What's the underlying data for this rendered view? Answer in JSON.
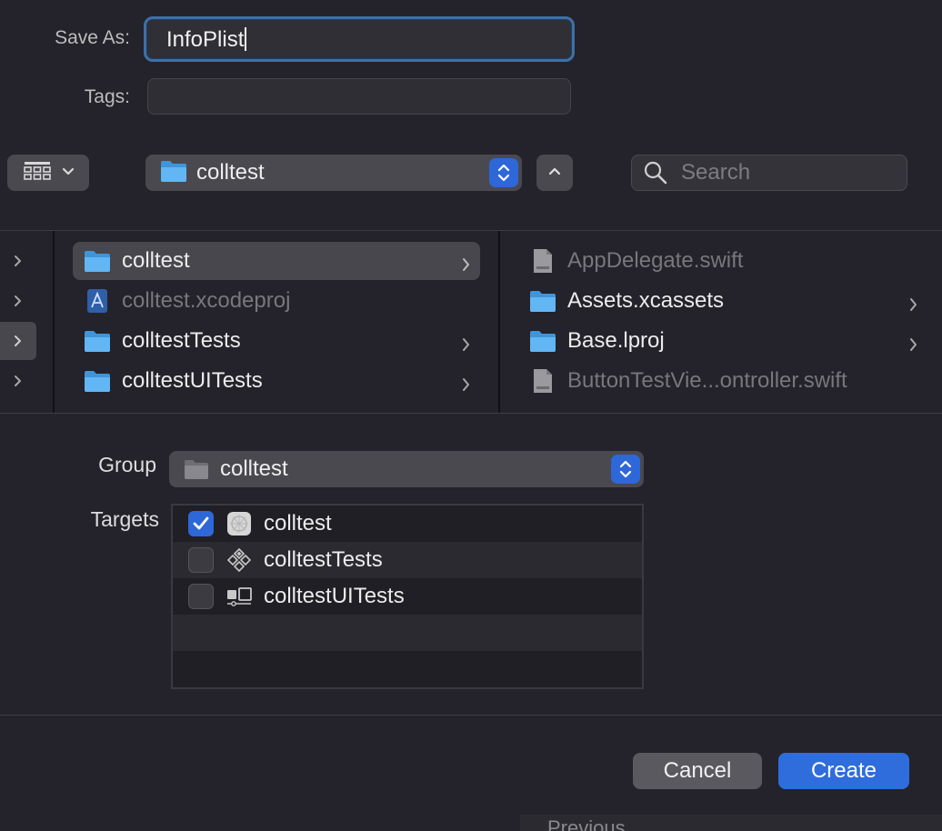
{
  "form": {
    "save_as_label": "Save As:",
    "save_as_value": "InfoPlist",
    "tags_label": "Tags:",
    "tags_value": ""
  },
  "toolbar": {
    "location": "colltest",
    "search_placeholder": "Search"
  },
  "browser": {
    "column1": [
      {
        "name": "colltest",
        "type": "folder",
        "selected": true,
        "has_children": true
      },
      {
        "name": "colltest.xcodeproj",
        "type": "xcodeproj",
        "dimmed": true,
        "has_children": false
      },
      {
        "name": "colltestTests",
        "type": "folder",
        "has_children": true
      },
      {
        "name": "colltestUITests",
        "type": "folder",
        "has_children": true
      }
    ],
    "column2": [
      {
        "name": "AppDelegate.swift",
        "type": "swift",
        "dimmed": true
      },
      {
        "name": "Assets.xcassets",
        "type": "folder",
        "has_children": true
      },
      {
        "name": "Base.lproj",
        "type": "folder",
        "has_children": true
      },
      {
        "name": "ButtonTestVie...ontroller.swift",
        "type": "swift",
        "dimmed": true
      }
    ]
  },
  "options": {
    "group_label": "Group",
    "group_value": "colltest",
    "targets_label": "Targets",
    "targets": [
      {
        "name": "colltest",
        "checked": true,
        "icon": "app-target-icon"
      },
      {
        "name": "colltestTests",
        "checked": false,
        "icon": "unit-test-icon"
      },
      {
        "name": "colltestUITests",
        "checked": false,
        "icon": "ui-test-icon"
      }
    ]
  },
  "buttons": {
    "cancel": "Cancel",
    "create": "Create"
  },
  "background": {
    "peek_text": "Previous"
  },
  "colors": {
    "accent": "#2e6ddb",
    "folder": "#5ab0f0",
    "dialog_bg": "#24222a"
  }
}
